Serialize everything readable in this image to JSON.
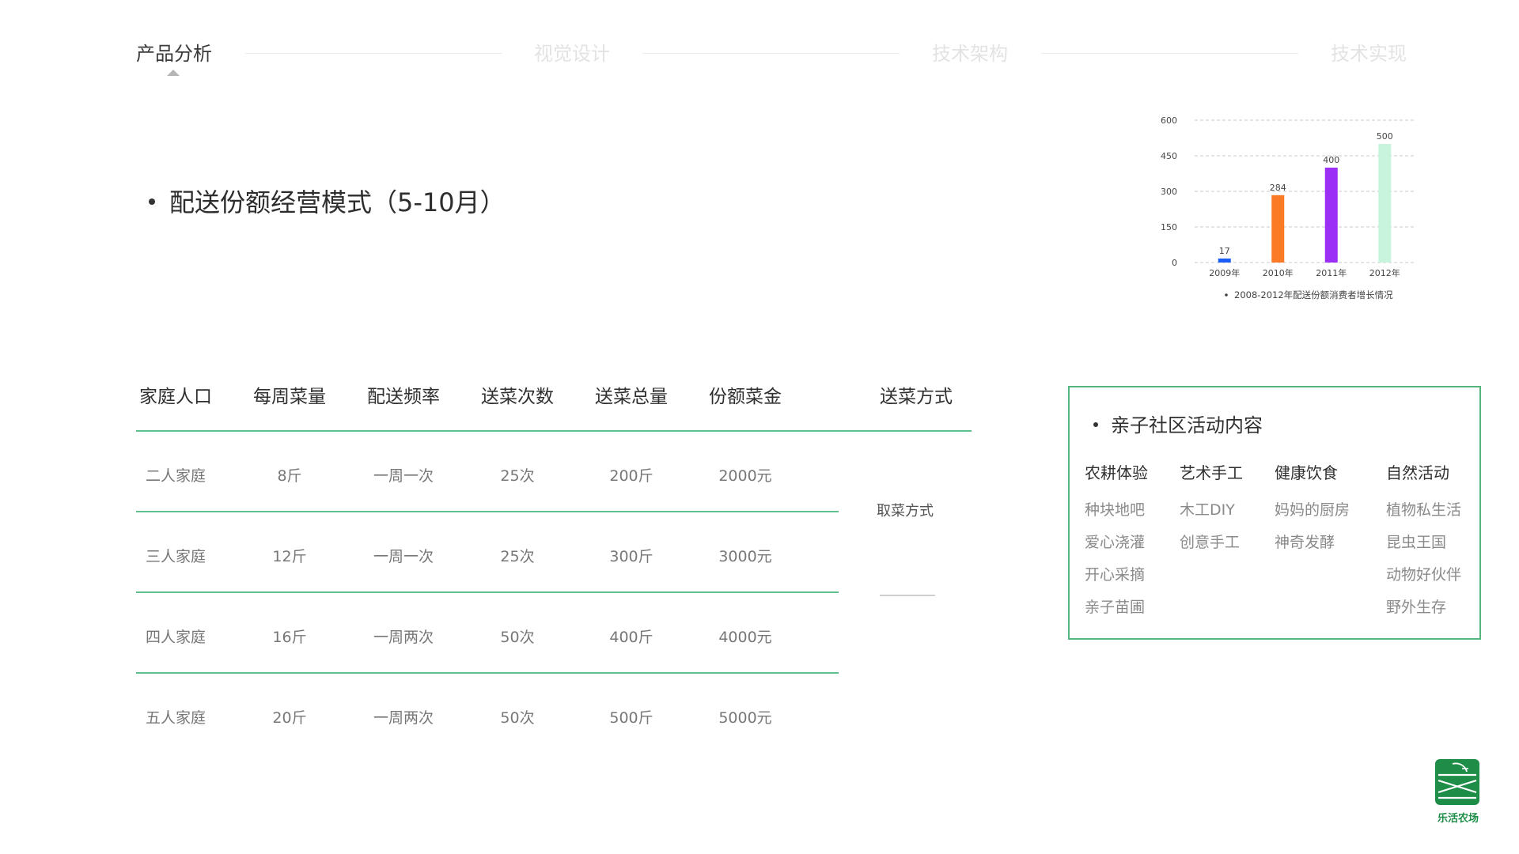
{
  "nav": {
    "items": [
      {
        "label": "产品分析",
        "active": true
      },
      {
        "label": "视觉设计",
        "active": false
      },
      {
        "label": "技术架构",
        "active": false
      },
      {
        "label": "技术实现",
        "active": false
      }
    ]
  },
  "section": {
    "title": "配送份额经营模式（5-10月）"
  },
  "chart_data": {
    "type": "bar",
    "categories": [
      "2009年",
      "2010年",
      "2011年",
      "2012年"
    ],
    "values": [
      17,
      284,
      400,
      500
    ],
    "data_labels": [
      "17",
      "284",
      "400",
      "500"
    ],
    "yticks": [
      "0",
      "150",
      "300",
      "450",
      "600"
    ],
    "ylim": [
      0,
      600
    ],
    "grid": true,
    "bar_colors": [
      "#1a5cf5",
      "#fb7a25",
      "#9b2ff5",
      "#c8f3dc"
    ],
    "caption": "2008-2012年配送份额消费者增长情况"
  },
  "table": {
    "headers": [
      "家庭人口",
      "每周菜量",
      "配送频率",
      "送菜次数",
      "送菜总量",
      "份额菜金",
      "送菜方式"
    ],
    "rows": [
      [
        "二人家庭",
        "8斤",
        "一周一次",
        "25次",
        "200斤",
        "2000元"
      ],
      [
        "三人家庭",
        "12斤",
        "一周一次",
        "25次",
        "300斤",
        "3000元"
      ],
      [
        "四人家庭",
        "16斤",
        "一周两次",
        "50次",
        "400斤",
        "4000元"
      ],
      [
        "五人家庭",
        "20斤",
        "一周两次",
        "50次",
        "500斤",
        "5000元"
      ]
    ],
    "method": "取菜方式"
  },
  "activity": {
    "title": "亲子社区活动内容",
    "columns": [
      {
        "heading": "农耕体验",
        "items": [
          "种块地吧",
          "爱心浇灌",
          "开心采摘",
          "亲子苗圃"
        ]
      },
      {
        "heading": "艺术手工",
        "items": [
          "木工DIY",
          "创意手工"
        ]
      },
      {
        "heading": "健康饮食",
        "items": [
          "妈妈的厨房",
          "神奇发酵"
        ]
      },
      {
        "heading": "自然活动",
        "items": [
          "植物私生活",
          "昆虫王国",
          "动物好伙伴",
          "野外生存"
        ]
      }
    ]
  },
  "logo": {
    "text": "乐活农场",
    "icon": "farm-field-logo-icon",
    "color": "#1e8d48"
  },
  "colors": {
    "accent": "#5fbf8f",
    "box_border": "#56b57c"
  }
}
